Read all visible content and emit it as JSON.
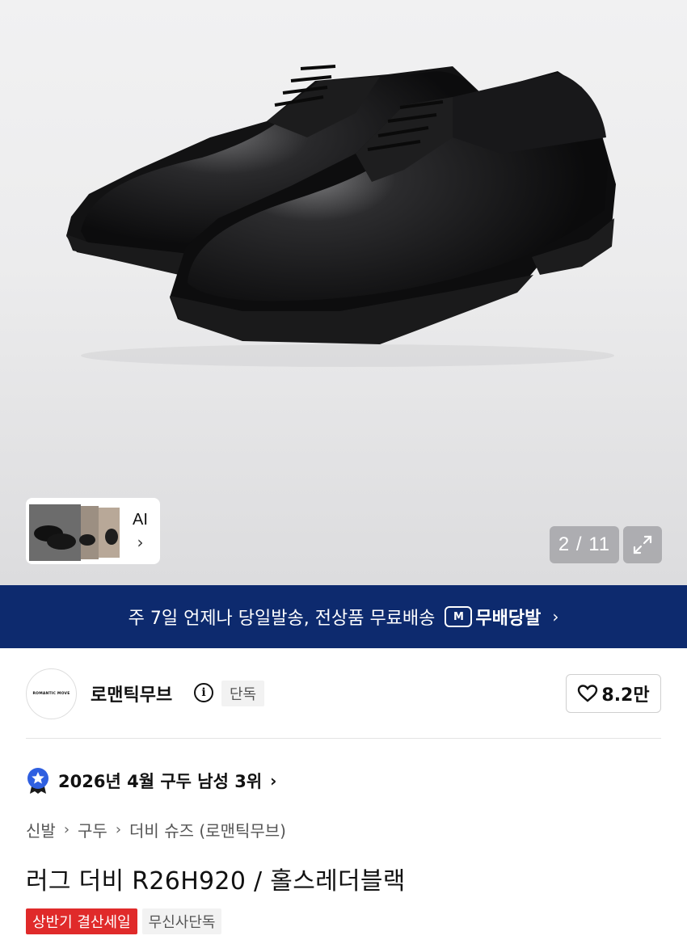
{
  "gallery": {
    "counter": "2 / 11",
    "ai_label": "AI",
    "ai_chevron": "›",
    "expand_icon": "expand-icon",
    "product_image_icon": "shoe-photo"
  },
  "banner": {
    "text": "주 7일 언제나 당일발송, 전상품 무료배송",
    "badge_icon_text": "M",
    "badge_label": "무배당발",
    "chevron": "›",
    "bg_color": "#0d2a6e"
  },
  "brand": {
    "logo_text": "ROMANTIC MOVE",
    "name": "로맨틱무브",
    "info_icon": "i",
    "exclusive_tag": "단독",
    "likes": "8.2만"
  },
  "ranking": {
    "text": "2026년 4월 구두 남성 3위",
    "chevron": "›"
  },
  "breadcrumb": [
    "신발",
    "구두",
    "더비 슈즈 (로맨틱무브)"
  ],
  "breadcrumb_sep": "›",
  "product": {
    "title": "러그 더비 R26H920 / 홀스레더블랙",
    "tags": {
      "sale": "상반기 결산세일",
      "exclusive": "무신사단독"
    },
    "sale_color": "#e02a2a"
  }
}
